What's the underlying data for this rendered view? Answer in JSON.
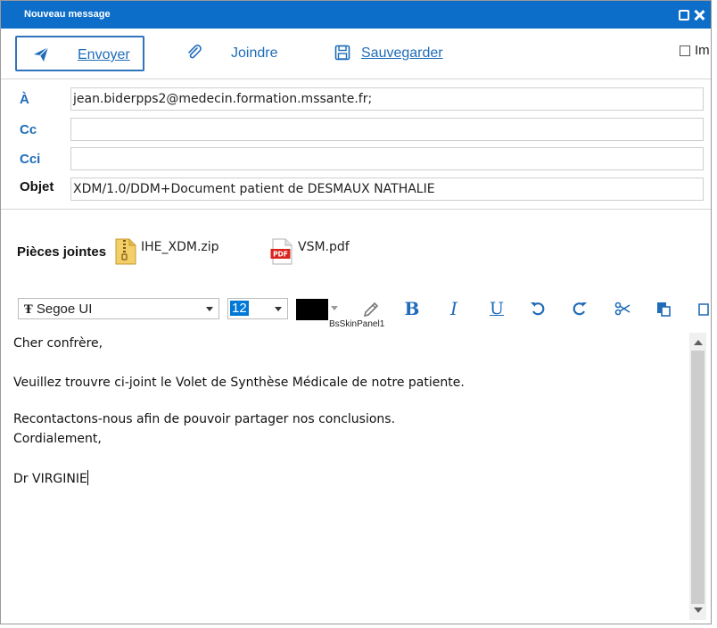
{
  "window": {
    "title": "Nouveau message",
    "maximize_icon": "maximize-icon",
    "close_icon": "close-icon"
  },
  "toolbar": {
    "send_label": "Envoyer",
    "attach_label": "Joindre",
    "save_label": "Sauvegarder",
    "checkbox_label": "Im",
    "send_icon": "paper-plane-icon",
    "attach_icon": "paperclip-icon",
    "save_icon": "floppy-disk-icon"
  },
  "fields": {
    "to_label": "À",
    "to_value": "jean.biderpps2@medecin.formation.mssante.fr;",
    "cc_label": "Cc",
    "cc_value": "",
    "bcc_label": "Cci",
    "bcc_value": "",
    "subject_label": "Objet",
    "subject_value": "XDM/1.0/DDM+Document patient de DESMAUX NATHALIE"
  },
  "attachments": {
    "label": "Pièces jointes",
    "items": [
      {
        "name": "IHE_XDM.zip",
        "icon": "zip-file-icon"
      },
      {
        "name": "VSM.pdf",
        "icon": "pdf-file-icon"
      }
    ]
  },
  "format_bar": {
    "font_icon": "font-icon",
    "font_name": "Segoe UI",
    "font_size": "12",
    "color_hex": "#000000",
    "skin_label": "BsSkinPanel1",
    "bold_label": "B",
    "italic_label": "I",
    "underline_label": "U"
  },
  "body": {
    "lines": [
      "Cher confrère,",
      "Veuillez trouvre ci-joint le Volet de Synthèse Médicale de notre patiente.",
      "Recontactons-nous afin de pouvoir partager nos conclusions.",
      "Cordialement,",
      "Dr VIRGINIE"
    ]
  },
  "colors": {
    "titlebar": "#0d6ec9",
    "accent": "#1f6cb8",
    "selection": "#0078d7"
  }
}
